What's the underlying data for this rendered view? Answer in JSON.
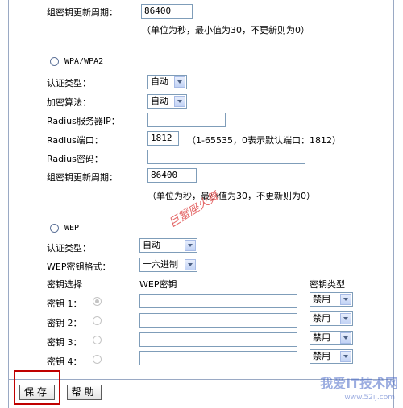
{
  "top": {
    "group_key_update_label": "组密钥更新周期：",
    "group_key_update_value": "86400",
    "group_key_hint": "（单位为秒，最小值为30，不更新则为0）"
  },
  "wpa": {
    "title": "WPA/WPA2",
    "auth_type_label": "认证类型：",
    "auth_type_value": "自动",
    "encrypt_label": "加密算法：",
    "encrypt_value": "自动",
    "radius_ip_label": "Radius服务器IP：",
    "radius_ip_value": "",
    "radius_port_label": "Radius端口：",
    "radius_port_value": "1812",
    "radius_port_hint": "（1-65535，0表示默认端口：1812）",
    "radius_pwd_label": "Radius密码：",
    "radius_pwd_value": "",
    "group_key_update_label": "组密钥更新周期：",
    "group_key_update_value": "86400",
    "group_key_hint": "（单位为秒，最小值为30，不更新则为0）"
  },
  "watermark": "巨蟹座火舞",
  "wep": {
    "title": "WEP",
    "auth_type_label": "认证类型：",
    "auth_type_value": "自动",
    "key_format_label": "WEP密钥格式：",
    "key_format_value": "十六进制",
    "col_key_select": "密钥选择",
    "col_wep_key": "WEP密钥",
    "col_key_type": "密钥类型",
    "keys": [
      {
        "label": "密钥 1：",
        "value": "",
        "type": "禁用"
      },
      {
        "label": "密钥 2：",
        "value": "",
        "type": "禁用"
      },
      {
        "label": "密钥 3：",
        "value": "",
        "type": "禁用"
      },
      {
        "label": "密钥 4：",
        "value": "",
        "type": "禁用"
      }
    ]
  },
  "buttons": {
    "save": "保存",
    "help": "帮助"
  },
  "site": {
    "name": "我爱IT技术网",
    "url": "www.52ij.com"
  },
  "colors": {
    "border": "#9aa9c4",
    "highlight": "#c00000",
    "select_arrow": "#c1d2f5"
  }
}
